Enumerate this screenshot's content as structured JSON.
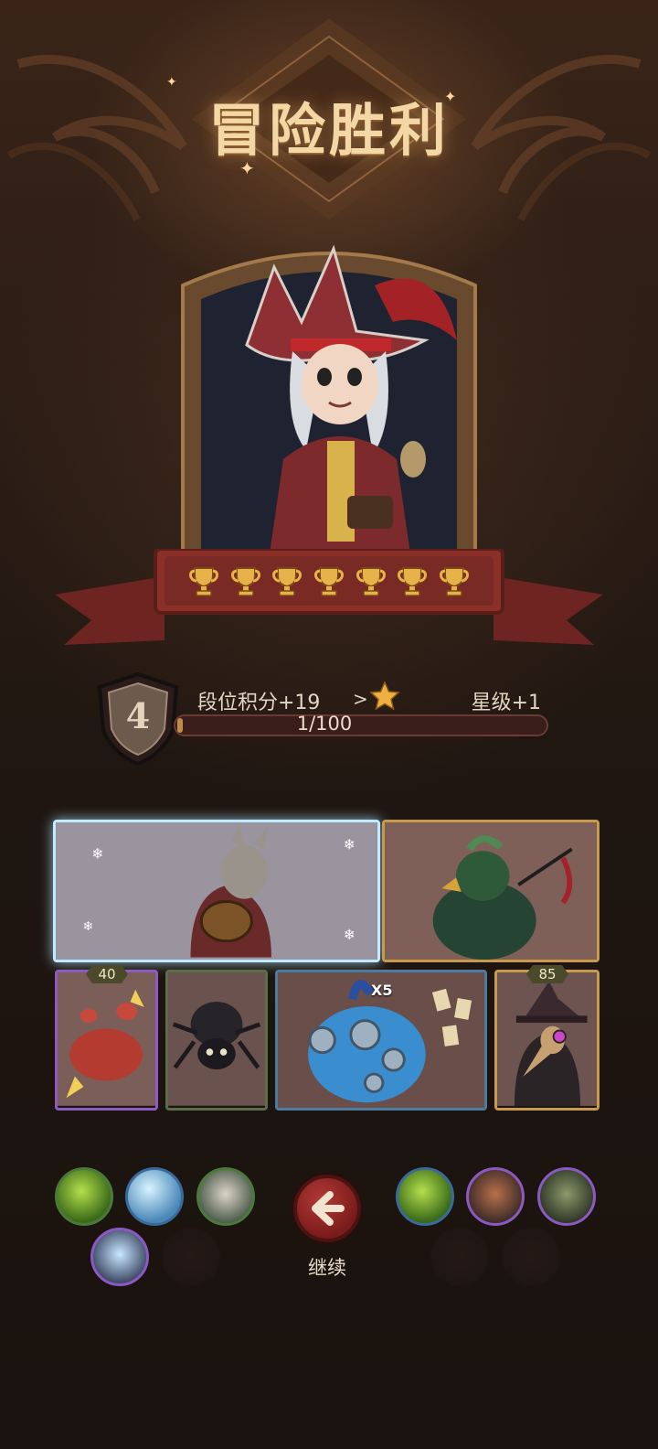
{
  "header": {
    "title": "冒险胜利"
  },
  "hero": {
    "trophy_count": 7,
    "trophy_icon": "trophy-icon"
  },
  "rank": {
    "level": "4",
    "points_label": "段位积分+19",
    "arrow": ">",
    "star_icon": "star-icon",
    "star_level_label": "星级+1",
    "progress_text": "1/100",
    "progress_fraction": 0.01
  },
  "cards": {
    "frost_donkey_bard": {
      "icon": "donkey-bard-portrait"
    },
    "raven_pirate": {
      "icon": "raven-pirate-portrait"
    },
    "crab_warrior": {
      "icon": "crab-warrior-portrait",
      "badge": "40"
    },
    "black_spider": {
      "icon": "spider-portrait"
    },
    "clock_monster": {
      "icon": "clock-monster-portrait",
      "multiplier": "X5"
    },
    "plague_doctor": {
      "icon": "plague-doctor-portrait",
      "badge": "85"
    }
  },
  "actions": {
    "continue_label": "继续",
    "continue_icon": "arrow-left-icon"
  },
  "colors": {
    "gold": "#f3d8a6",
    "banner_red": "#7e2e28",
    "button_red": "#a32c28"
  }
}
